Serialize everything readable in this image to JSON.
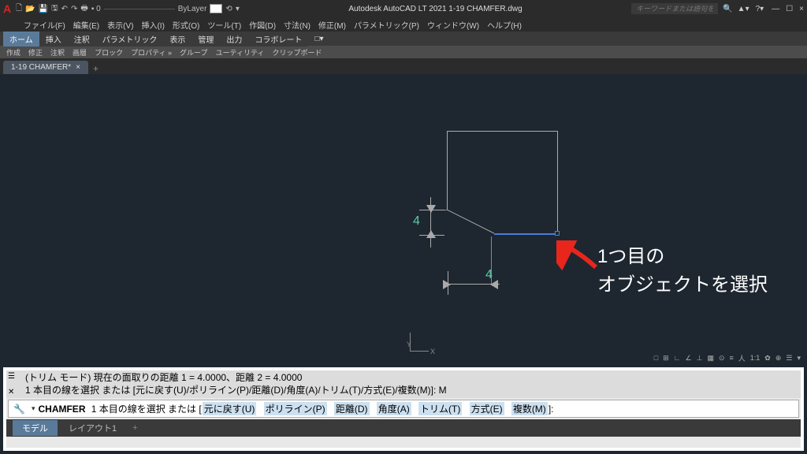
{
  "titlebar": {
    "logo": "A",
    "layer_selector": "ByLayer",
    "app_title": "Autodesk AutoCAD LT 2021   1-19 CHAMFER.dwg",
    "search_placeholder": "キーワードまたは語句を入力",
    "signin": "▲",
    "window_min": "—",
    "window_restore": "☐",
    "window_close": "×"
  },
  "menu": {
    "items": [
      "ファイル(F)",
      "編集(E)",
      "表示(V)",
      "挿入(I)",
      "形式(O)",
      "ツール(T)",
      "作図(D)",
      "寸法(N)",
      "修正(M)",
      "パラメトリック(P)",
      "ウィンドウ(W)",
      "ヘルプ(H)"
    ]
  },
  "ribbon": {
    "tabs": [
      "ホーム",
      "挿入",
      "注釈",
      "パラメトリック",
      "表示",
      "管理",
      "出力",
      "コラボレート",
      "□▾"
    ],
    "panels": [
      "作成",
      "修正",
      "注釈",
      "画層",
      "ブロック",
      "プロパティ »",
      "グループ",
      "ユーティリティ",
      "クリップボード"
    ]
  },
  "file_tabs": {
    "active": "1-19 CHAMFER*",
    "close": "×",
    "plus": "+"
  },
  "drawing": {
    "dim_vertical": "4",
    "dim_horizontal": "4"
  },
  "ucs": {
    "x": "X",
    "y": "Y"
  },
  "annotation": {
    "line1": "1つ目の",
    "line2": "オブジェクトを選択"
  },
  "command": {
    "hist_line1": "(トリム モード) 現在の面取りの距離 1 = 4.0000、距離 2 = 4.0000",
    "hist_line2": "1 本目の線を選択 または [元に戻す(U)/ポリライン(P)/距離(D)/角度(A)/トリム(T)/方式(E)/複数(M)]: M",
    "prompt_cmd": "CHAMFER",
    "prompt_text": "1 本目の線を選択 または [",
    "opts": [
      "元に戻す(U)",
      "ポリライン(P)",
      "距離(D)",
      "角度(A)",
      "トリム(T)",
      "方式(E)",
      "複数(M)"
    ],
    "prompt_end": "]:"
  },
  "bottom_tabs": {
    "model": "モデル",
    "layout1": "レイアウト1",
    "plus": "+"
  },
  "status": {
    "items": [
      "□",
      "⊞",
      "∟",
      "∠",
      "⊥",
      "▦",
      "⊙",
      "≡",
      "人",
      "1:1",
      "✿",
      "⊕",
      "☰",
      "▾"
    ]
  }
}
